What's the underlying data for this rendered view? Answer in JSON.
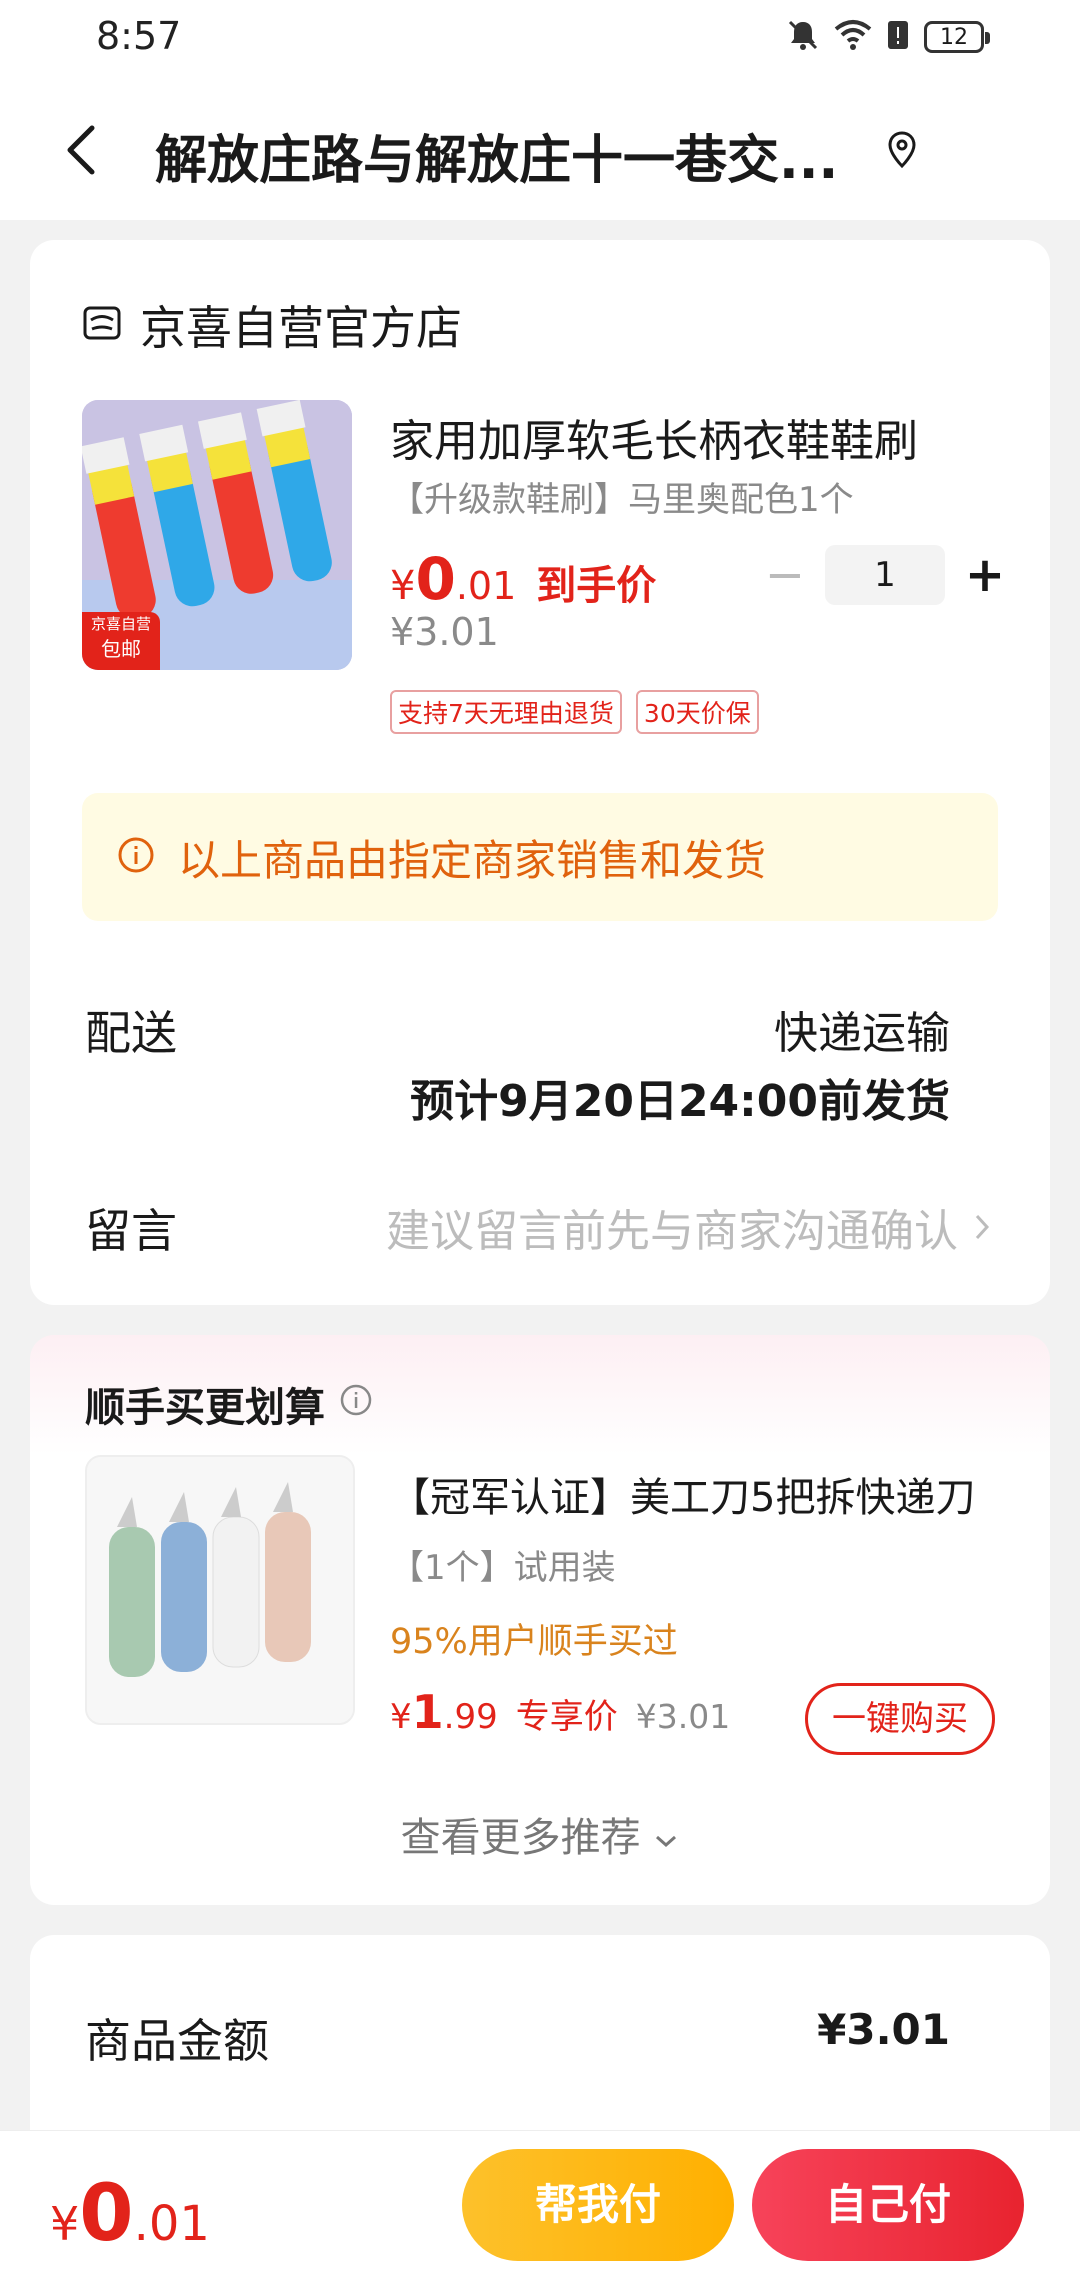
{
  "status_bar": {
    "time": "8:57",
    "battery": "12"
  },
  "header": {
    "title": "解放庄路与解放庄十一巷交..."
  },
  "shop": {
    "name": "京喜自营官方店",
    "product": {
      "title": "家用加厚软毛长柄衣鞋鞋刷",
      "spec": "【升级款鞋刷】马里奥配色1个",
      "price_yen": "¥",
      "price_int": "0",
      "price_dec": ".01",
      "price_tag": "到手价",
      "original_price": "¥3.01",
      "quantity": "1",
      "image_badge_top": "京喜自营",
      "image_badge_bottom": "包邮",
      "tags": [
        "支持7天无理由退货",
        "30天价保"
      ]
    },
    "notice": "以上商品由指定商家销售和发货",
    "delivery": {
      "label": "配送",
      "method": "快递运输",
      "eta": "预计9月20日24:00前发货"
    },
    "memo": {
      "label": "留言",
      "placeholder": "建议留言前先与商家沟通确认"
    }
  },
  "recommend": {
    "title": "顺手买更划算",
    "item": {
      "name": "【冠军认证】美工刀5把拆快递刀",
      "spec": "【1个】试用装",
      "users": "95%用户顺手买过",
      "price_yen": "¥",
      "price_int": "1",
      "price_dec": ".99",
      "price_label": "专享价",
      "original_price": "¥3.01",
      "button": "一键购买"
    },
    "more": "查看更多推荐"
  },
  "summary": {
    "amount_label": "商品金额",
    "amount_value": "¥3.01"
  },
  "bottom": {
    "total_yen": "¥",
    "total_int": "0",
    "total_dec": ".01",
    "help_pay": "帮我付",
    "self_pay": "自己付"
  },
  "colors": {
    "accent": "#e2231a",
    "notice_bg": "#fffbe3",
    "notice_text": "#e0620d",
    "help_pay": "#fdc12b",
    "self_pay": "#f03a4a"
  }
}
